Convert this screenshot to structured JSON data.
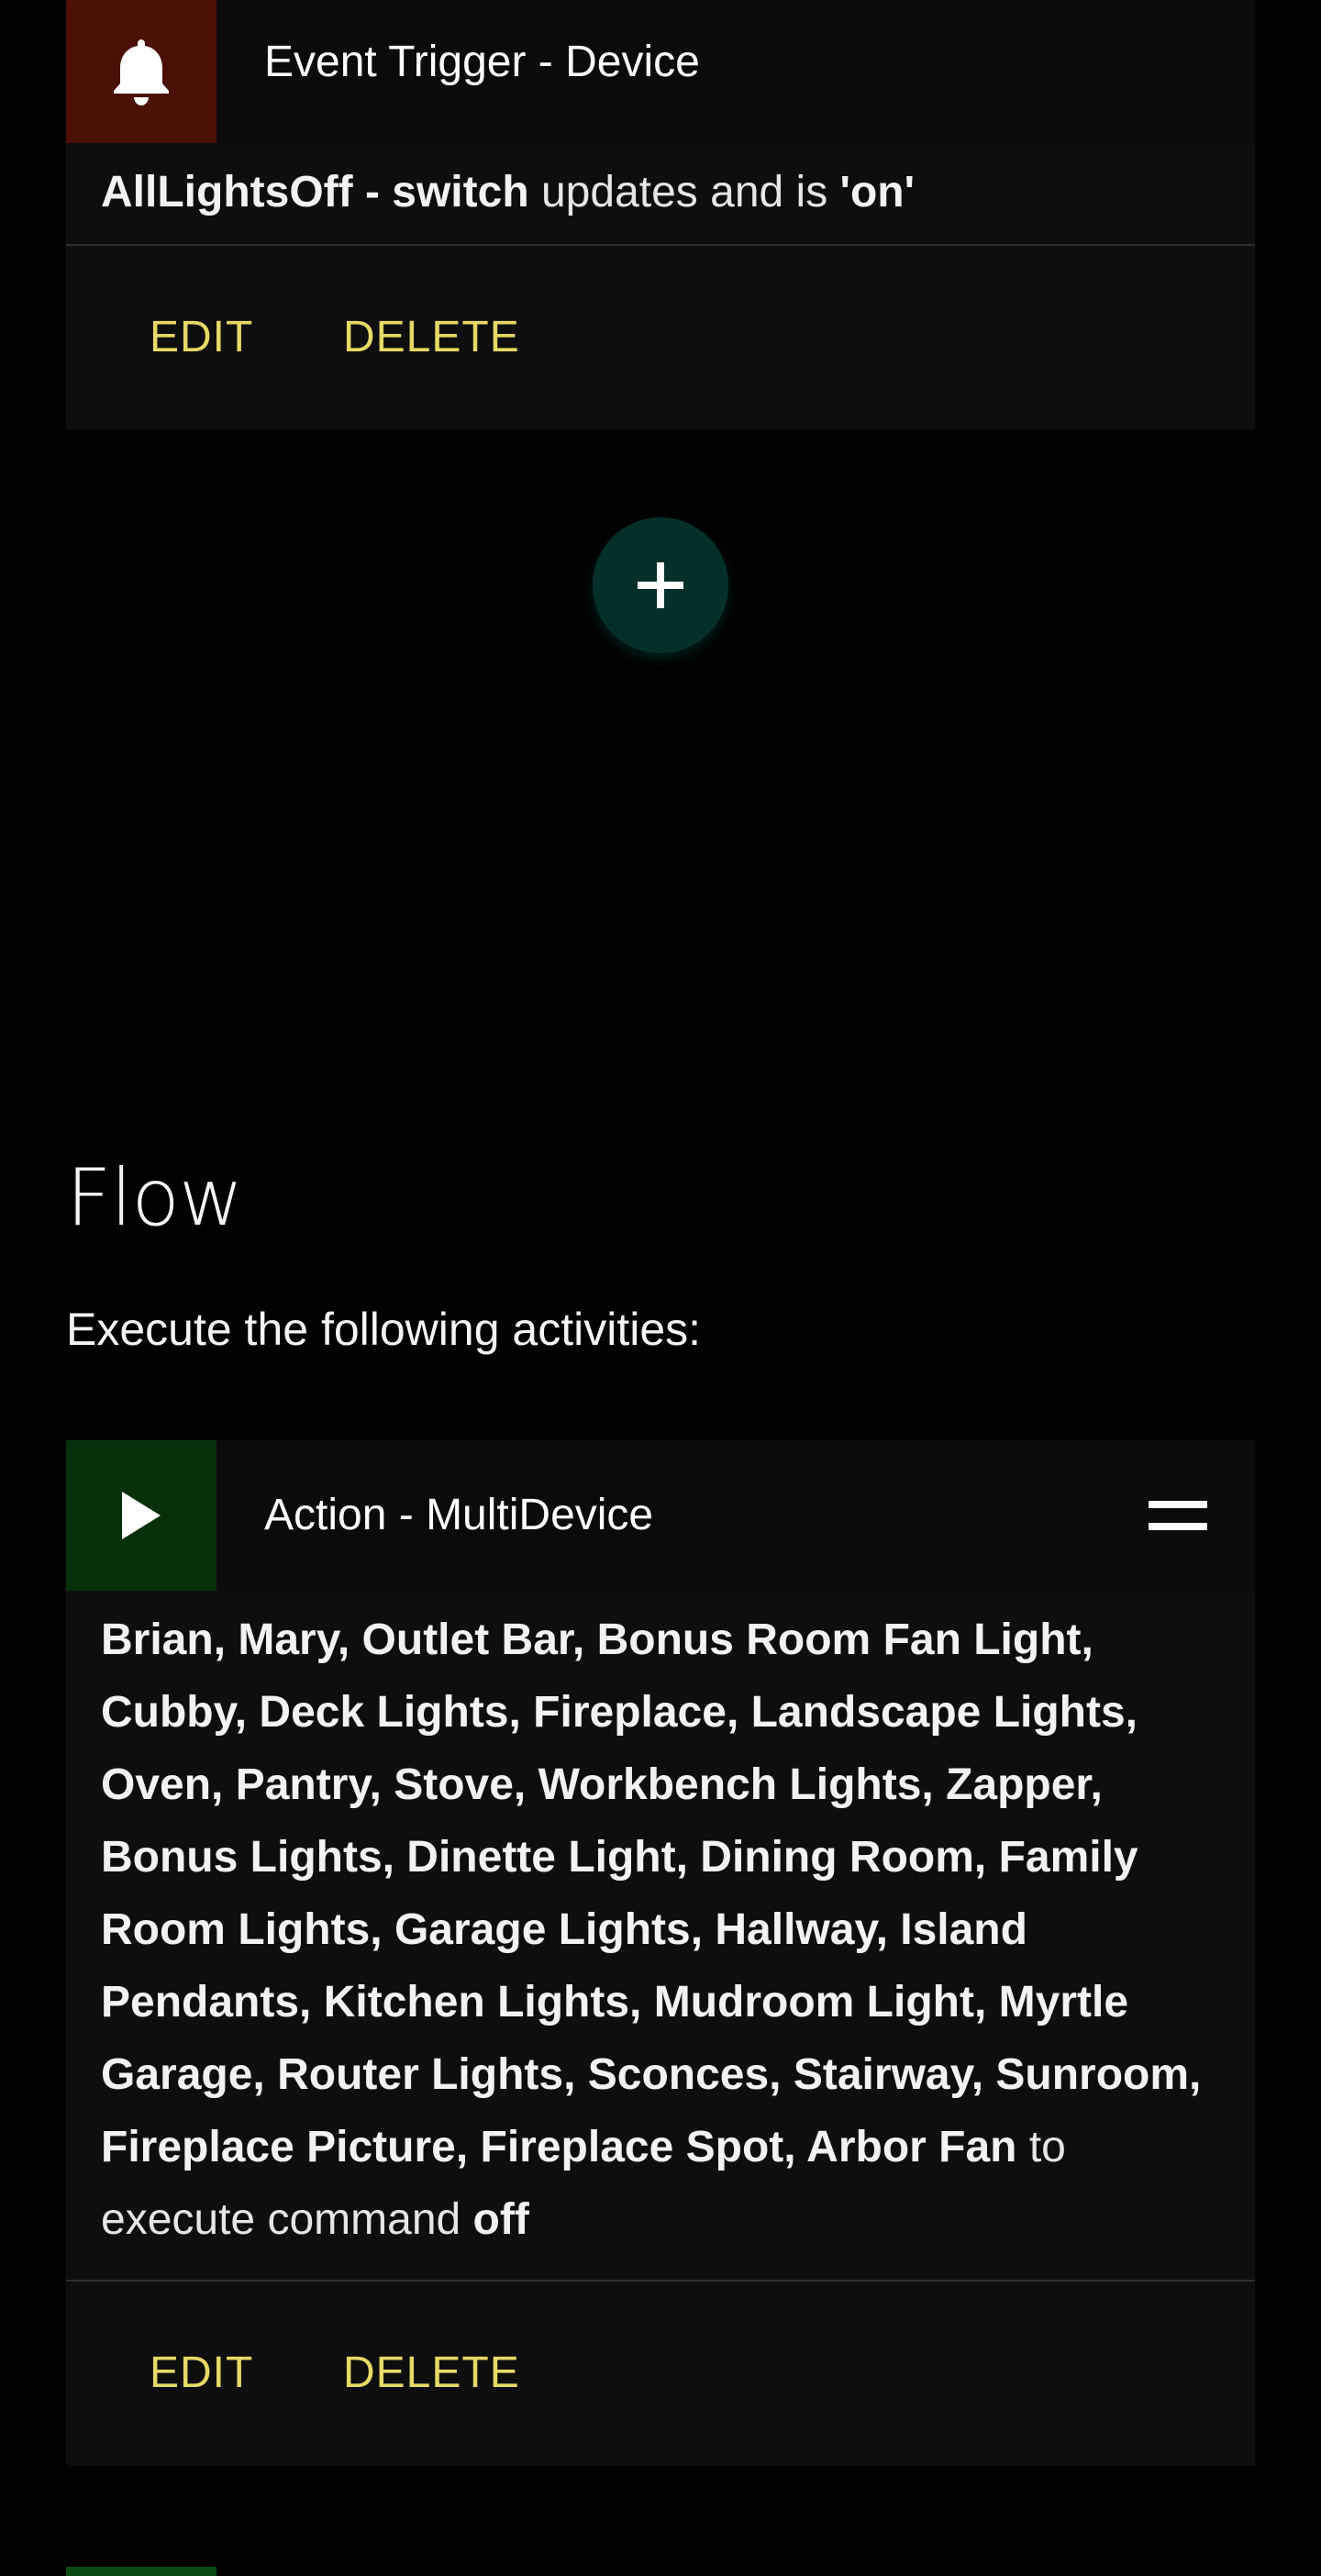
{
  "trigger_card": {
    "title": "Event Trigger - Device",
    "icon": "bell-icon",
    "icon_bg": "#4a0f05",
    "body": {
      "device": "AllLightsOff - switch",
      "mid_text": " updates and is ",
      "value": "'on'"
    },
    "edit_label": "EDIT",
    "delete_label": "DELETE"
  },
  "add_button": {
    "icon": "plus-icon",
    "color": "#05302a"
  },
  "flow": {
    "title": "Flow",
    "subtitle": "Execute the following activities:"
  },
  "action_card": {
    "title": "Action - MultiDevice",
    "icon": "play-icon",
    "icon_bg": "#06300a",
    "devices": "Brian, Mary, Outlet Bar, Bonus Room Fan Light, Cubby, Deck Lights, Fireplace, Landscape Lights, Oven, Pantry, Stove, Workbench Lights, Zapper, Bonus Lights, Dinette Light, Dining Room, Family Room Lights, Garage Lights, Hallway, Island Pendants, Kitchen Lights, Mudroom Light, Myrtle Garage, Router Lights, Sconces, Stairway, Sunroom, Fireplace Picture, Fireplace Spot, Arbor Fan",
    "connector": " to execute command ",
    "command": "off",
    "edit_label": "EDIT",
    "delete_label": "DELETE",
    "drag_icon": "drag-handle-icon"
  },
  "colors": {
    "accent_text": "#e8d866",
    "card_bg": "#0e0e0e",
    "page_bg": "#000000"
  }
}
